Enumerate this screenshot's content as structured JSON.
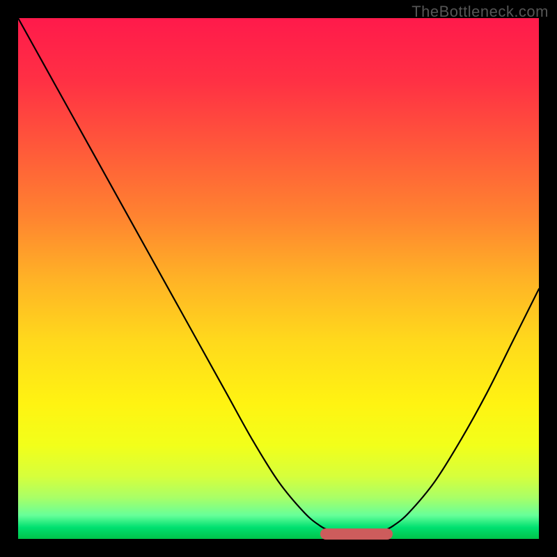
{
  "watermark": "TheBottleneck.com",
  "chart_data": {
    "type": "line",
    "title": "",
    "xlabel": "",
    "ylabel": "",
    "xlim": [
      0,
      100
    ],
    "ylim": [
      0,
      100
    ],
    "x": [
      0,
      5,
      10,
      15,
      20,
      25,
      30,
      35,
      40,
      45,
      50,
      55,
      58,
      60,
      62,
      65,
      68,
      70,
      72,
      75,
      80,
      85,
      90,
      95,
      100
    ],
    "values": [
      100,
      91,
      82,
      73,
      64,
      55,
      46,
      37,
      28,
      19,
      11,
      5,
      2.5,
      1.5,
      1,
      1,
      1,
      1.5,
      2.5,
      5,
      11,
      19,
      28,
      38,
      48
    ],
    "annotations": [
      {
        "type": "min-marker",
        "x_start": 58,
        "x_end": 72,
        "y": 1
      }
    ],
    "background_gradient": {
      "stops": [
        {
          "pos": 0.0,
          "color": "#ff1a4b"
        },
        {
          "pos": 0.12,
          "color": "#ff3044"
        },
        {
          "pos": 0.25,
          "color": "#ff593a"
        },
        {
          "pos": 0.38,
          "color": "#ff8330"
        },
        {
          "pos": 0.5,
          "color": "#ffb226"
        },
        {
          "pos": 0.62,
          "color": "#ffd91c"
        },
        {
          "pos": 0.74,
          "color": "#fff312"
        },
        {
          "pos": 0.82,
          "color": "#f2ff1a"
        },
        {
          "pos": 0.88,
          "color": "#d6ff3c"
        },
        {
          "pos": 0.92,
          "color": "#aaff66"
        },
        {
          "pos": 0.955,
          "color": "#66ff99"
        },
        {
          "pos": 0.978,
          "color": "#00e070"
        },
        {
          "pos": 1.0,
          "color": "#00c44a"
        }
      ]
    }
  }
}
